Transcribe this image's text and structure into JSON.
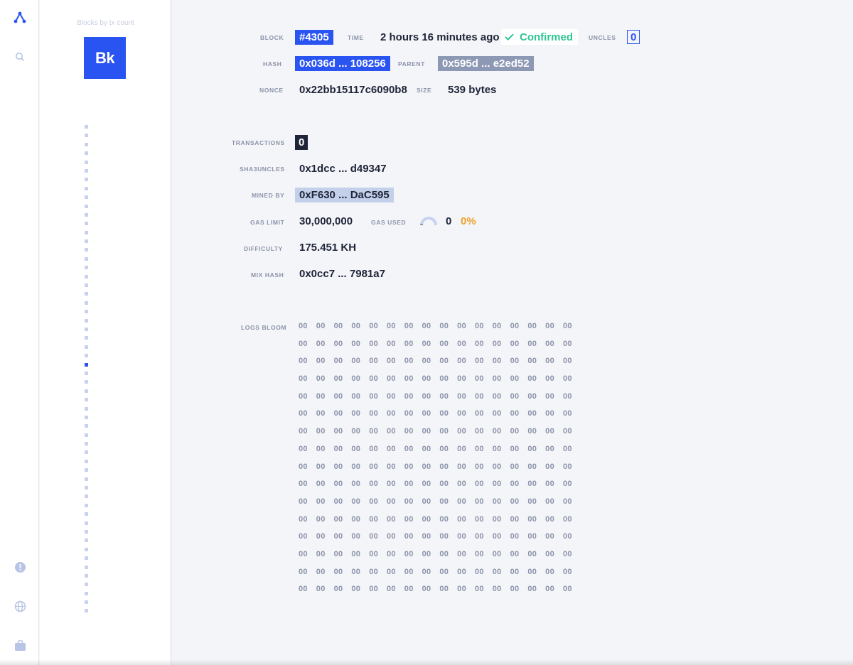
{
  "rail": {
    "icons": [
      "logo-icon",
      "search-icon",
      "alert-icon",
      "globe-icon",
      "briefcase-icon"
    ]
  },
  "column": {
    "title": "Blocks by tx count",
    "badge": "Bk"
  },
  "block": {
    "labels": {
      "block": "BLOCK",
      "time": "TIME",
      "uncles": "UNCLES",
      "hash": "HASH",
      "parent": "PARENT",
      "nonce": "NONCE",
      "size": "SIZE",
      "transactions": "TRANSACTIONS",
      "sha3uncles": "SHA3UNCLES",
      "mined_by": "MINED BY",
      "gas_limit": "GAS LIMIT",
      "gas_used": "GAS USED",
      "difficulty": "DIFFICULTY",
      "mix_hash": "MIX HASH",
      "logs_bloom": "LOGS BLOOM"
    },
    "number": "#4305",
    "time": "2 hours 16 minutes ago",
    "status": "Confirmed",
    "uncles": "0",
    "hash": "0x036d ... 108256",
    "parent": "0x595d ... e2ed52",
    "nonce": "0x22bb15117c6090b8",
    "size": "539 bytes",
    "transactions": "0",
    "sha3uncles": "0x1dcc ... d49347",
    "mined_by": "0xF630 ... DaC595",
    "gas_limit": "30,000,000",
    "gas_used": "0",
    "gas_used_pct": "0%",
    "difficulty": "175.451 KH",
    "mix_hash": "0x0cc7 ... 7981a7",
    "logs_bloom_byte": "00"
  },
  "colors": {
    "accent": "#2a54f1",
    "confirmed": "#2fc495",
    "percent": "#f0a12e"
  }
}
